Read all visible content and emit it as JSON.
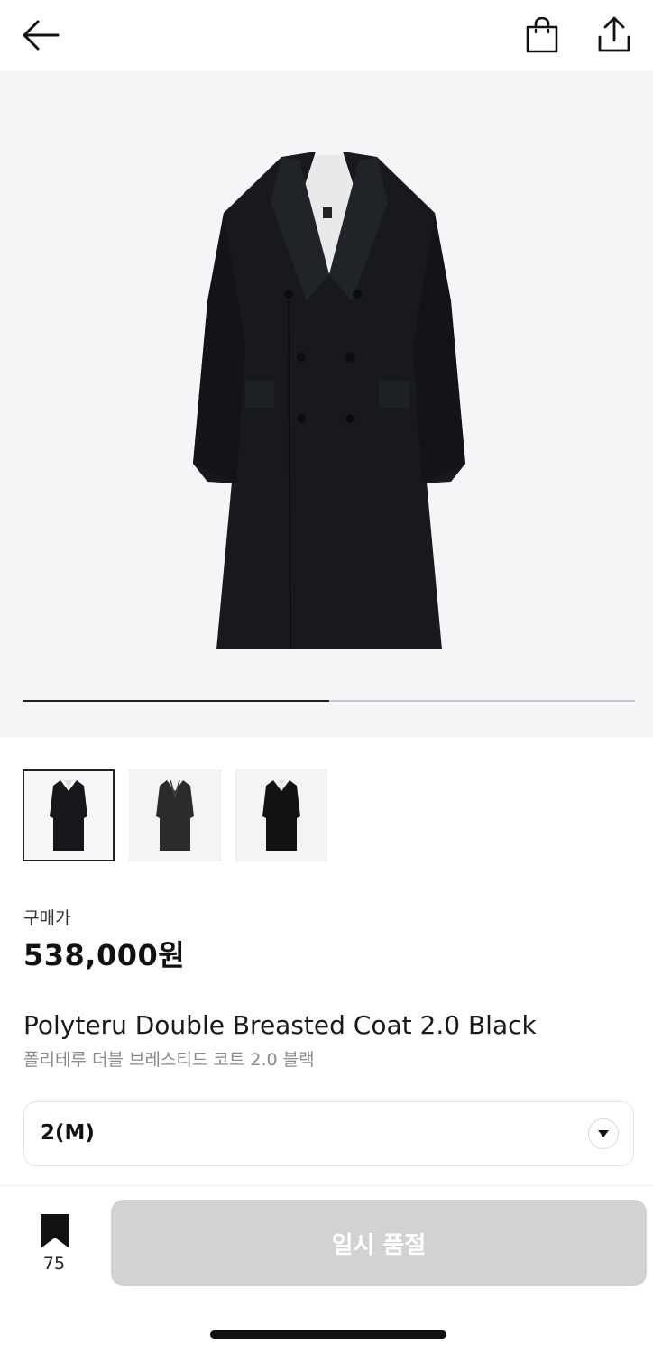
{
  "header": {
    "back_icon": "arrow-left-icon",
    "bag_icon": "shopping-bag-icon",
    "share_icon": "share-upload-icon"
  },
  "gallery": {
    "total_images": 3,
    "current_index": 1,
    "progress": 0.5,
    "thumbnails": [
      {
        "variant": "black",
        "selected": true
      },
      {
        "variant": "charcoal",
        "selected": false
      },
      {
        "variant": "black-front",
        "selected": false
      }
    ]
  },
  "price": {
    "label": "구매가",
    "value": "538,000원"
  },
  "product": {
    "name_en": "Polyteru Double Breasted Coat 2.0 Black",
    "name_ko": "폴리테루 더블 브레스티드 코트 2.0 블랙"
  },
  "size_select": {
    "value": "2(M)",
    "icon": "chevron-down-circle-icon"
  },
  "bottom_bar": {
    "wishlist_icon": "bookmark-icon",
    "wishlist_count": "75",
    "action_label": "일시 품절"
  },
  "colors": {
    "accent_disabled": "#d2d2d4",
    "image_bg": "#f5f5f7",
    "text_primary": "#111111",
    "text_secondary": "#8a8a8a"
  }
}
